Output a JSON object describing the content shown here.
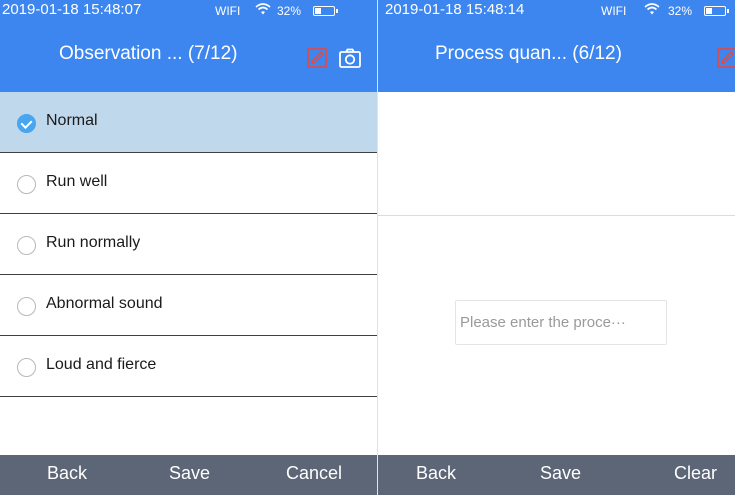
{
  "left": {
    "status": {
      "time": "2019-01-18 15:48:07",
      "network": "WIFI",
      "battery": "32%"
    },
    "title": "Observation ... (7/12)",
    "options": [
      {
        "label": "Normal",
        "selected": true
      },
      {
        "label": "Run well",
        "selected": false
      },
      {
        "label": "Run normally",
        "selected": false
      },
      {
        "label": "Abnormal sound",
        "selected": false
      },
      {
        "label": "Loud and fierce",
        "selected": false
      }
    ],
    "toolbar": {
      "back": "Back",
      "save": "Save",
      "cancel": "Cancel"
    }
  },
  "right": {
    "status": {
      "time": "2019-01-18 15:48:14",
      "network": "WIFI",
      "battery": "32%"
    },
    "title": "Process quan... (6/12)",
    "input": {
      "placeholder": "Please enter the proce···",
      "value": ""
    },
    "toolbar": {
      "back": "Back",
      "save": "Save",
      "clear": "Clear"
    }
  },
  "colors": {
    "header": "#3d86f0",
    "toolbar": "#5c6677",
    "selected_row": "#c0d8ec",
    "radio_checked": "#48a5ee",
    "edit_icon": "#e8473b"
  },
  "icons": {
    "edit": "pencil-icon",
    "camera": "camera-icon",
    "wifi": "wifi-icon",
    "battery": "battery-icon",
    "check": "check-icon"
  }
}
